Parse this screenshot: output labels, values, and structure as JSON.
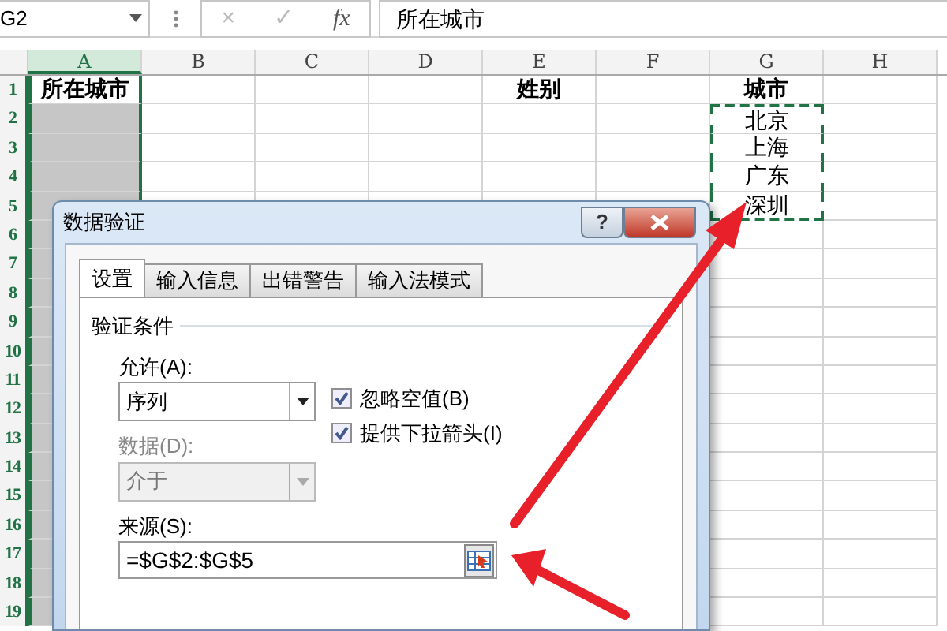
{
  "name_box": {
    "value": "G2"
  },
  "formula_buttons": [
    {
      "label": "×",
      "disabled": true
    },
    {
      "label": "✓",
      "disabled": true
    },
    {
      "label": "fx",
      "disabled": false
    }
  ],
  "formula_bar": {
    "value": "所在城市"
  },
  "columns": [
    {
      "label": "A",
      "selected": true
    },
    {
      "label": "B",
      "selected": false
    },
    {
      "label": "C",
      "selected": false
    },
    {
      "label": "D",
      "selected": false
    },
    {
      "label": "E",
      "selected": false
    },
    {
      "label": "F",
      "selected": false
    },
    {
      "label": "G",
      "selected": false
    },
    {
      "label": "H",
      "selected": false
    }
  ],
  "rows": [
    {
      "number": "1",
      "cells": [
        {
          "text": "所在城市",
          "active": true,
          "marquee": false,
          "bold": true
        },
        null,
        null,
        null,
        {
          "text": "姓别",
          "active": false,
          "marquee": false,
          "bold": true
        },
        null,
        {
          "text": "城市",
          "active": false,
          "marquee": false,
          "bold": true
        },
        null
      ]
    },
    {
      "number": "2",
      "cells": [
        null,
        null,
        null,
        null,
        null,
        null,
        {
          "text": "北京",
          "active": false,
          "marquee": true,
          "bold": false
        },
        null
      ]
    },
    {
      "number": "3",
      "cells": [
        null,
        null,
        null,
        null,
        null,
        null,
        {
          "text": "上海",
          "active": false,
          "marquee": true,
          "bold": false
        },
        null
      ]
    },
    {
      "number": "4",
      "cells": [
        null,
        null,
        null,
        null,
        null,
        null,
        {
          "text": "广东",
          "active": false,
          "marquee": true,
          "bold": false
        },
        null
      ]
    },
    {
      "number": "5",
      "cells": [
        null,
        null,
        null,
        null,
        null,
        null,
        {
          "text": "深圳",
          "active": false,
          "marquee": true,
          "bold": false
        },
        null
      ]
    },
    {
      "number": "6",
      "cells": [
        null,
        null,
        null,
        null,
        null,
        null,
        null,
        null
      ]
    },
    {
      "number": "7",
      "cells": [
        null,
        null,
        null,
        null,
        null,
        null,
        null,
        null
      ]
    },
    {
      "number": "8",
      "cells": [
        null,
        null,
        null,
        null,
        null,
        null,
        null,
        null
      ]
    },
    {
      "number": "9",
      "cells": [
        null,
        null,
        null,
        null,
        null,
        null,
        null,
        null
      ]
    },
    {
      "number": "10",
      "cells": [
        null,
        null,
        null,
        null,
        null,
        null,
        null,
        null
      ]
    },
    {
      "number": "11",
      "cells": [
        null,
        null,
        null,
        null,
        null,
        null,
        null,
        null
      ]
    },
    {
      "number": "12",
      "cells": [
        null,
        null,
        null,
        null,
        null,
        null,
        null,
        null
      ]
    },
    {
      "number": "13",
      "cells": [
        null,
        null,
        null,
        null,
        null,
        null,
        null,
        null
      ]
    },
    {
      "number": "14",
      "cells": [
        null,
        null,
        null,
        null,
        null,
        null,
        null,
        null
      ]
    },
    {
      "number": "15",
      "cells": [
        null,
        null,
        null,
        null,
        null,
        null,
        null,
        null
      ]
    },
    {
      "number": "16",
      "cells": [
        null,
        null,
        null,
        null,
        null,
        null,
        null,
        null
      ]
    },
    {
      "number": "17",
      "cells": [
        null,
        null,
        null,
        null,
        null,
        null,
        null,
        null
      ]
    },
    {
      "number": "18",
      "cells": [
        null,
        null,
        null,
        null,
        null,
        null,
        null,
        null
      ]
    },
    {
      "number": "19",
      "cells": [
        null,
        null,
        null,
        null,
        null,
        null,
        null,
        null
      ]
    }
  ],
  "dialog": {
    "title": "数据验证",
    "help_label": "?",
    "tabs": [
      {
        "label": "设置",
        "selected": true
      },
      {
        "label": "输入信息",
        "selected": false
      },
      {
        "label": "出错警告",
        "selected": false
      },
      {
        "label": "输入法模式",
        "selected": false
      }
    ],
    "group_label": "验证条件",
    "allow": {
      "label": "允许(A):",
      "value": "序列",
      "disabled": false
    },
    "data": {
      "label": "数据(D):",
      "value": "介于",
      "disabled": true
    },
    "checkboxes": [
      {
        "label": "忽略空值(B)",
        "checked": true
      },
      {
        "label": "提供下拉箭头(I)",
        "checked": true
      }
    ],
    "source": {
      "label": "来源(S):",
      "value": "=$G$2:$G$5"
    }
  }
}
